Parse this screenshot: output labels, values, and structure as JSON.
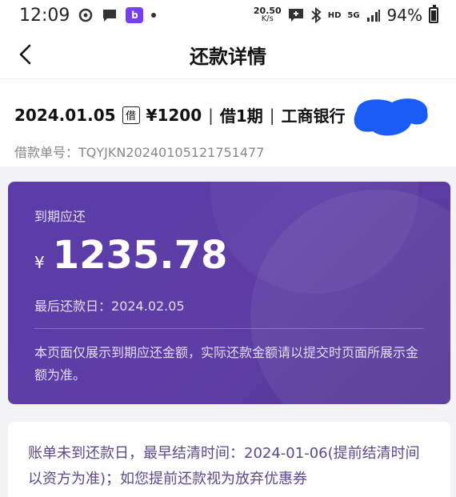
{
  "status_bar": {
    "time": "12:09",
    "speed_value": "20.50",
    "speed_unit": "K/s",
    "hd": "HD",
    "network": "5G",
    "battery": "94%",
    "app_badge": "b"
  },
  "header": {
    "title": "还款详情"
  },
  "loan": {
    "date": "2024.01.05",
    "tag": "借",
    "amount": "¥1200",
    "sep": "|",
    "term": "借1期",
    "bank": "工商银行",
    "order_label": "借款单号：",
    "order_no": "TQYJKN20240105121751477"
  },
  "due_card": {
    "label": "到期应还",
    "currency": "¥",
    "amount": "1235.78",
    "last_day_label": "最后还款日：",
    "last_day": "2024.02.05",
    "note": "本页面仅展示到期应还金额，实际还款金额请以提交时页面所展示金额为准。"
  },
  "notice": {
    "text": "账单未到还款日，最早结清时间：2024-01-06(提前结清时间以资方为准)；如您提前还款视为放弃优惠券"
  },
  "colors": {
    "card_purple": "#5b3ca8",
    "redaction_blue": "#1a5cf5"
  }
}
